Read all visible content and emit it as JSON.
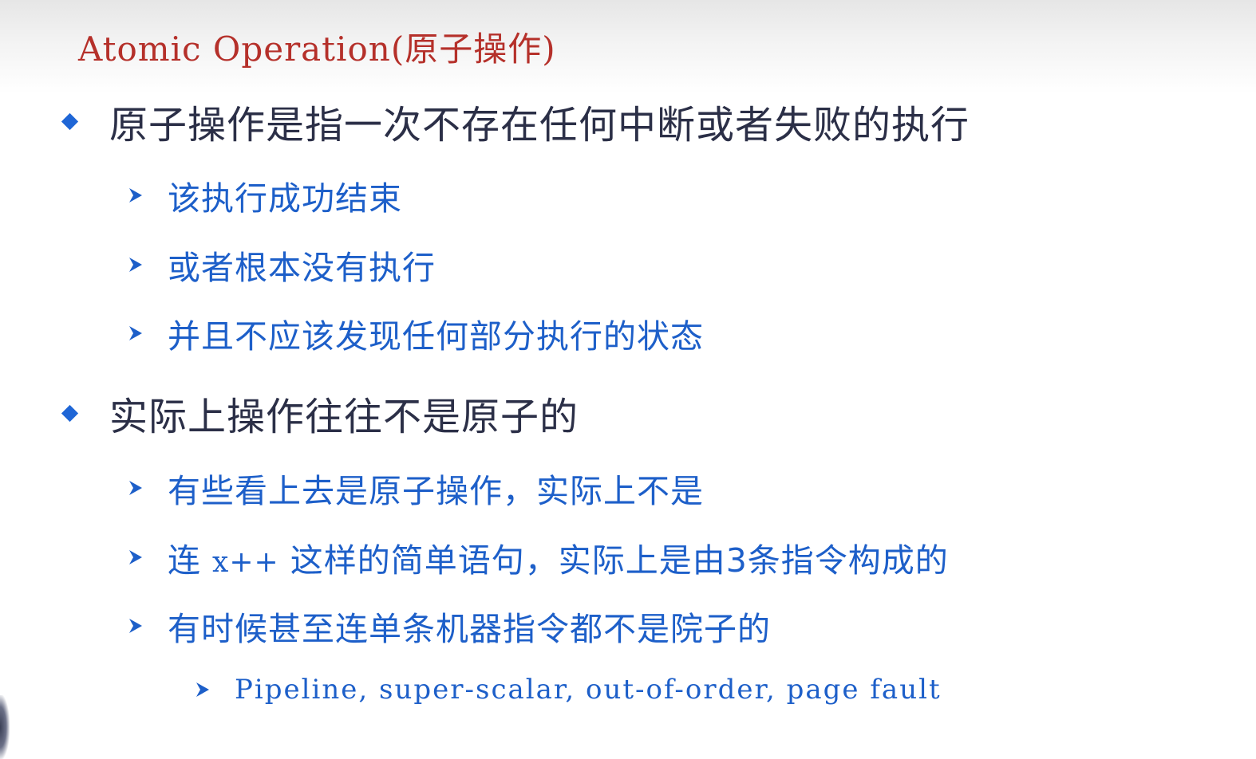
{
  "slide": {
    "title": "Atomic Operation(原子操作)",
    "sections": [
      {
        "text": "原子操作是指一次不存在任何中断或者失败的执行",
        "items": [
          "该执行成功结束",
          "或者根本没有执行",
          "并且不应该发现任何部分执行的状态"
        ]
      },
      {
        "text": "实际上操作往往不是原子的",
        "items": [
          "有些看上去是原子操作，实际上不是",
          {
            "prefix": "连 ",
            "code": "x++",
            "suffix": " 这样的简单语句，实际上是由3条指令构成的"
          },
          "有时候甚至连单条机器指令都不是院子的"
        ],
        "subitems": [
          "Pipeline, super-scalar, out-of-order, page fault"
        ]
      }
    ]
  },
  "colors": {
    "title": "#b5302a",
    "level1_text": "#2b2f47",
    "level2_text": "#1d5fc9",
    "bullet": "#1f66d6"
  },
  "icons": {
    "level1_bullet": "diamond-bullet-icon",
    "level2_bullet": "arrow-bullet-icon"
  }
}
